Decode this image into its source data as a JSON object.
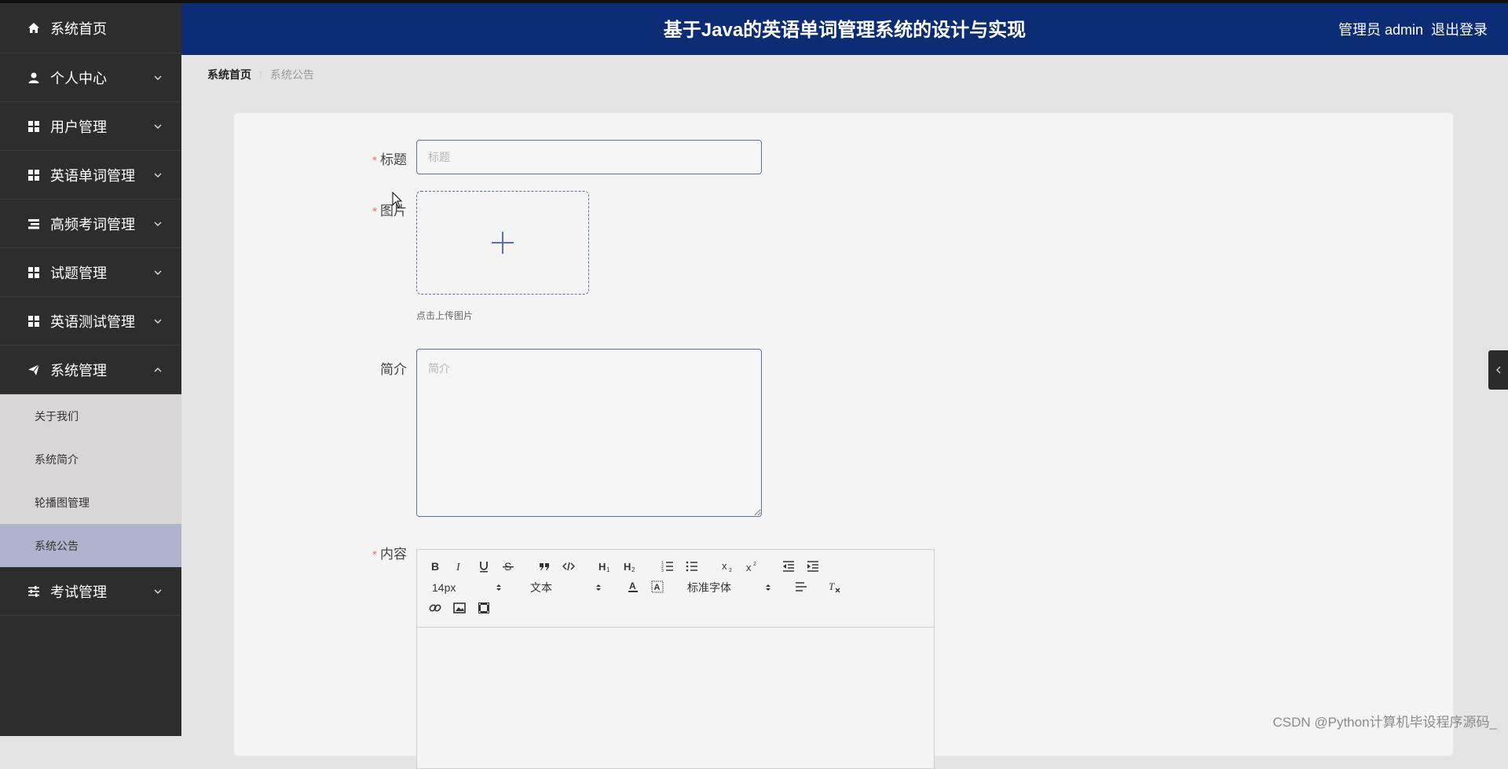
{
  "app": {
    "title": "基于Java的英语单词管理系统的设计与实现"
  },
  "header": {
    "user_label": "管理员 admin",
    "logout_label": "退出登录"
  },
  "sidebar": {
    "items": [
      {
        "label": "系统首页",
        "icon": "home-icon"
      },
      {
        "label": "个人中心",
        "icon": "user-icon"
      },
      {
        "label": "用户管理",
        "icon": "grid-icon"
      },
      {
        "label": "英语单词管理",
        "icon": "grid-icon"
      },
      {
        "label": "高频考词管理",
        "icon": "list-icon"
      },
      {
        "label": "试题管理",
        "icon": "grid-icon"
      },
      {
        "label": "英语测试管理",
        "icon": "grid-icon"
      },
      {
        "label": "系统管理",
        "icon": "send-icon",
        "expanded": true
      },
      {
        "label": "考试管理",
        "icon": "sliders-icon"
      }
    ],
    "submenu": [
      {
        "label": "关于我们"
      },
      {
        "label": "系统简介"
      },
      {
        "label": "轮播图管理"
      },
      {
        "label": "系统公告",
        "active": true
      }
    ]
  },
  "breadcrumb": {
    "home": "系统首页",
    "current": "系统公告"
  },
  "form": {
    "title": {
      "label": "标题",
      "placeholder": "标题",
      "value": ""
    },
    "image": {
      "label": "图片",
      "tip": "点击上传图片"
    },
    "intro": {
      "label": "简介",
      "placeholder": "简介",
      "value": ""
    },
    "content": {
      "label": "内容"
    }
  },
  "editor": {
    "font_size": "14px",
    "paragraph": "文本",
    "font_family": "标准字体"
  },
  "watermark": "CSDN @Python计算机毕设程序源码_",
  "colors": {
    "header": "#0c2c76",
    "sidebar": "#2d2d2d",
    "active_sub": "#aeb4cc",
    "required": "#f56c6c"
  }
}
